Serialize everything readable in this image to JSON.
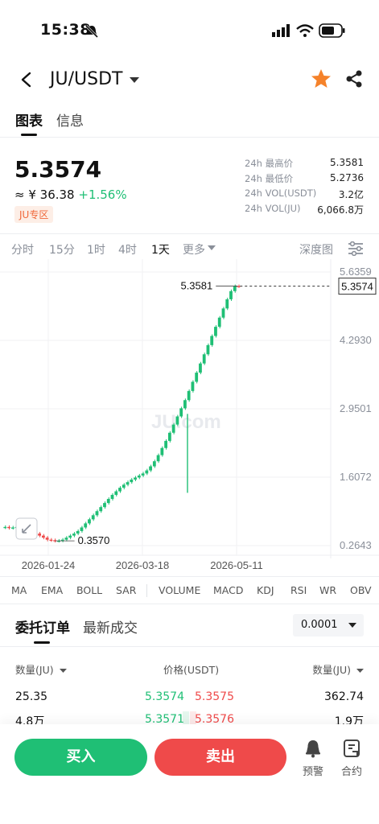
{
  "status_bar": {
    "time": "15:38"
  },
  "header": {
    "pair": "JU/USDT"
  },
  "tabs": [
    {
      "label": "图表"
    },
    {
      "label": "信息"
    }
  ],
  "ticker": {
    "last_price": "5.3574",
    "cny_price": "≈ ¥ 36.38",
    "change": "+1.56%",
    "zone": "JU专区",
    "stats": [
      {
        "label": "24h 最高价",
        "value": "5.3581"
      },
      {
        "label": "24h 最低价",
        "value": "5.2736"
      },
      {
        "label": "24h VOL(USDT)",
        "value": "3.2亿"
      },
      {
        "label": "24h VOL(JU)",
        "value": "6,066.8万"
      }
    ]
  },
  "intervals": [
    "分时",
    "15分",
    "1时",
    "4时",
    "1天",
    "更多"
  ],
  "depth_label": "深度图",
  "chart_data": {
    "type": "line",
    "x_ticks": [
      "2026-01-24",
      "2026-03-18",
      "2026-05-11"
    ],
    "y_ticks": [
      "5.6359",
      "4.2930",
      "2.9501",
      "1.6072",
      "0.2643"
    ],
    "ylim": [
      0.2643,
      5.6359
    ],
    "annotations": {
      "high": "5.3581",
      "low": "0.3570",
      "last": "5.3574"
    },
    "watermark": "JU.com",
    "series": [
      {
        "values": [
          0.62,
          0.63,
          0.61,
          0.62,
          0.63,
          0.62,
          0.61,
          0.6,
          0.56,
          0.5,
          0.46,
          0.42,
          0.38,
          0.37,
          0.357,
          0.36,
          0.38,
          0.42,
          0.46,
          0.5,
          0.55,
          0.62,
          0.7,
          0.78,
          0.86,
          0.94,
          1.02,
          1.1,
          1.18,
          1.26,
          1.33,
          1.4,
          1.46,
          1.51,
          1.56,
          1.6,
          1.64,
          1.68,
          1.74,
          1.82,
          1.92,
          2.04,
          2.18,
          2.32,
          2.48,
          2.64,
          2.8,
          2.96,
          3.12,
          3.3,
          3.48,
          3.66,
          3.84,
          4.02,
          4.2,
          4.38,
          4.56,
          4.74,
          4.92,
          5.1,
          5.26,
          5.3581,
          5.3574
        ]
      }
    ]
  },
  "indicators": [
    "MA",
    "EMA",
    "BOLL",
    "SAR",
    "VOLUME",
    "MACD",
    "KDJ",
    "RSI",
    "WR",
    "OBV"
  ],
  "orderbook": {
    "tabs": [
      "委托订单",
      "最新成交"
    ],
    "precision": "0.0001",
    "headers": {
      "left": "数量(JU)",
      "mid": "价格(USDT)",
      "right": "数量(JU)"
    },
    "rows": [
      {
        "bid_qty": "25.35",
        "bid": "5.3574",
        "ask": "5.3575",
        "ask_qty": "362.74"
      },
      {
        "bid_qty": "4.8万",
        "bid": "5.3571",
        "ask": "5.3576",
        "ask_qty": "1.9万"
      }
    ]
  },
  "actions": {
    "buy": "买入",
    "sell": "卖出",
    "alert": "预警",
    "contract": "合约",
    "buy_color": "#1fbf75",
    "sell_color": "#ef4a4a",
    "accent": "#f5822a"
  }
}
